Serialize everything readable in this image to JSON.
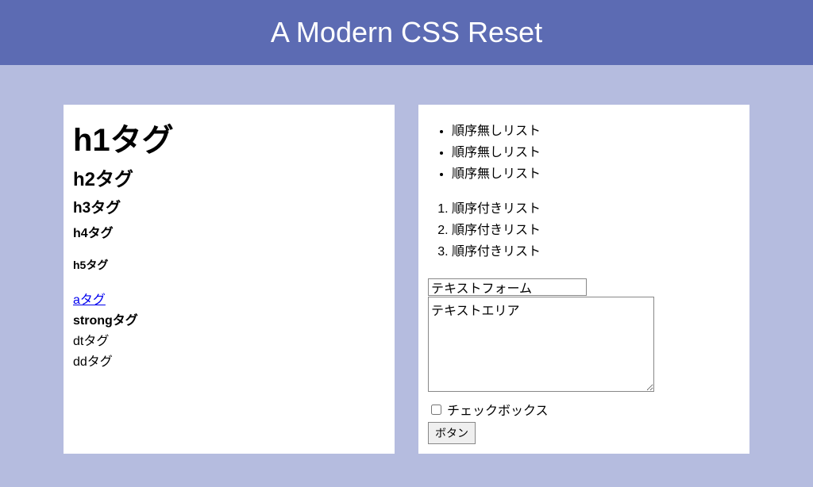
{
  "header": {
    "title": "A Modern CSS Reset"
  },
  "panelLeft": {
    "h1": "h1タグ",
    "h2": "h2タグ",
    "h3": "h3タグ",
    "h4": "h4タグ",
    "h5": "h5タグ",
    "link": "aタグ",
    "strong": "strongタグ",
    "dt": "dtタグ",
    "dd": "ddタグ"
  },
  "panelRight": {
    "ul": [
      "順序無しリスト",
      "順序無しリスト",
      "順序無しリスト"
    ],
    "ol": [
      "順序付きリスト",
      "順序付きリスト",
      "順序付きリスト"
    ],
    "textValue": "テキストフォーム",
    "textareaValue": "テキストエリア",
    "checkboxLabel": "チェックボックス",
    "buttonLabel": "ボタン"
  }
}
